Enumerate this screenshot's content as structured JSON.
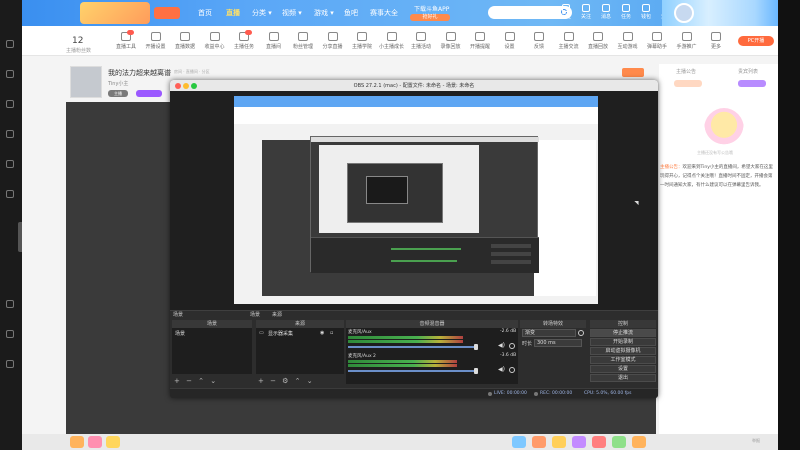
{
  "header": {
    "nav": [
      {
        "label": "首页"
      },
      {
        "label": "直播"
      },
      {
        "label": "分类 ▾"
      },
      {
        "label": "视频 ▾"
      },
      {
        "label": "游戏 ▾"
      },
      {
        "label": "鱼吧"
      },
      {
        "label": "赛事大全"
      }
    ],
    "download_app": "下载斗鱼APP",
    "download_app_sub": "抢好礼",
    "search_placeholder": "",
    "icons": [
      {
        "name": "history-icon",
        "label": "历史"
      },
      {
        "name": "follow-icon",
        "label": "关注"
      },
      {
        "name": "message-icon",
        "label": "消息"
      },
      {
        "name": "task-icon",
        "label": "任务"
      },
      {
        "name": "wallet-icon",
        "label": "钱包"
      },
      {
        "name": "live-icon",
        "label": "开播"
      }
    ]
  },
  "subbar": {
    "fans_count": "12",
    "fans_label": "主播粉丝数",
    "tools": [
      {
        "name": "tool-1",
        "label": "直播工具"
      },
      {
        "name": "tool-2",
        "label": "开播设置"
      },
      {
        "name": "tool-3",
        "label": "直播数据"
      },
      {
        "name": "tool-4",
        "label": "收益中心"
      },
      {
        "name": "tool-5",
        "label": "主播任务"
      },
      {
        "name": "tool-6",
        "label": "直播间"
      },
      {
        "name": "tool-7",
        "label": "粉丝管理"
      },
      {
        "name": "tool-8",
        "label": "分享直播"
      },
      {
        "name": "tool-9",
        "label": "主播学院"
      },
      {
        "name": "tool-10",
        "label": "小主播成长"
      },
      {
        "name": "tool-11",
        "label": "主播活动"
      },
      {
        "name": "tool-12",
        "label": "录像回放"
      },
      {
        "name": "tool-13",
        "label": "开播提醒"
      },
      {
        "name": "tool-14",
        "label": "设置"
      },
      {
        "name": "tool-15",
        "label": "反馈"
      },
      {
        "name": "tool-16",
        "label": "主播交流"
      },
      {
        "name": "tool-17",
        "label": "直播回放"
      },
      {
        "name": "tool-18",
        "label": "互动游戏"
      },
      {
        "name": "tool-19",
        "label": "弹幕助手"
      },
      {
        "name": "tool-20",
        "label": "手游推广"
      },
      {
        "name": "tool-21",
        "label": "更多"
      }
    ],
    "pc_live": "PC开播"
  },
  "room": {
    "title": "我的法力超来越离谱",
    "meta": "房间 · 直播间 · 分区",
    "owner": "Tiny小主",
    "tag1": "主播",
    "report": ""
  },
  "sidebar": {
    "tabs": [
      "主播公告",
      "贵宾列表"
    ],
    "mascot_caption": "主播还没有写公告哦",
    "notice_highlight": "主播公告：",
    "notice": "欢迎来到Tiny小主的直播间，希望大家在这里玩得开心，记得点个关注哦！直播时间不固定，开播会第一时间通知大家，有什么建议可以在弹幕里告诉我。"
  },
  "bottom": {
    "right_text": "举报"
  },
  "obs": {
    "title": "OBS 27.2.1 (mac) - 配置文件: 未命名 - 场景: 未命名",
    "docks": {
      "scenes_header": "场景",
      "sources_header": "来源",
      "mixer_header": "音频混音器",
      "transitions_header": "转场特效",
      "controls_header": "控制",
      "scene_tab_1": "场景",
      "scene_tab_2": "来源",
      "scene_item": "场景",
      "source_item": "显示器采集"
    },
    "mixer": [
      {
        "name": "麦克风/Aux",
        "db": "-2.6 dB",
        "level": 0.82
      },
      {
        "name": "麦克风/Aux 2",
        "db": "-3.6 dB",
        "level": 0.78
      }
    ],
    "transitions": {
      "type": "渐变",
      "duration_label": "时长",
      "duration": "300 ms"
    },
    "controls": [
      {
        "label": "停止推流"
      },
      {
        "label": "开始录制"
      },
      {
        "label": "启动虚拟摄像机"
      },
      {
        "label": "工作室模式"
      },
      {
        "label": "设置"
      },
      {
        "label": "退出"
      }
    ],
    "status": {
      "live": "LIVE: 00:00:00",
      "rec": "REC: 00:00:00",
      "cpu": "CPU: 5.0%, 60.00 fps"
    }
  },
  "colors": {
    "header_blue": "#4b9ff0",
    "accent_orange": "#ff7a3d",
    "obs_bg": "#2b2b2b"
  }
}
